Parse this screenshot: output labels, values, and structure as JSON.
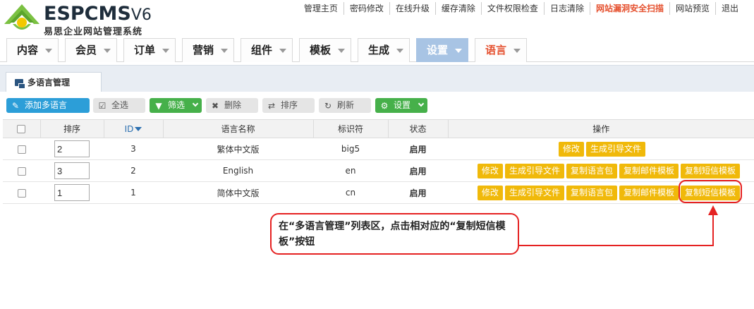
{
  "brand": {
    "name": "ESPCMS",
    "version": "V6",
    "subtitle": "易思企业网站管理系统"
  },
  "topnav": [
    "管理主页",
    "密码修改",
    "在线升级",
    "缓存清除",
    "文件权限检查",
    "日志清除",
    "网站漏洞安全扫描",
    "网站预览",
    "退出"
  ],
  "menu": [
    "内容",
    "会员",
    "订单",
    "营销",
    "组件",
    "模板",
    "生成",
    "设置",
    "语言"
  ],
  "tab": {
    "label": "多语言管理"
  },
  "toolbar": {
    "add": "添加多语言",
    "select_all": "全选",
    "filter": "筛选",
    "delete": "删除",
    "sort": "排序",
    "refresh": "刷新",
    "settings": "设置"
  },
  "table": {
    "headers": [
      "排序",
      "ID",
      "语言名称",
      "标识符",
      "状态",
      "操作"
    ],
    "rows": [
      {
        "sort": "2",
        "id": "3",
        "name": "繁体中文版",
        "code": "big5",
        "status": "启用",
        "ops": [
          "修改",
          "生成引导文件"
        ]
      },
      {
        "sort": "3",
        "id": "2",
        "name": "English",
        "code": "en",
        "status": "启用",
        "ops": [
          "修改",
          "生成引导文件",
          "复制语言包",
          "复制邮件模板",
          "复制短信模板"
        ]
      },
      {
        "sort": "1",
        "id": "1",
        "name": "简体中文版",
        "code": "cn",
        "status": "启用",
        "ops": [
          "修改",
          "生成引导文件",
          "复制语言包",
          "复制邮件模板",
          "复制短信模板"
        ]
      }
    ]
  },
  "annotation": {
    "text": "在“多语言管理”列表区，点击相对应的“复制短信模板”按钮"
  },
  "colors": {
    "accent_orange": "#f0b90a",
    "enabled_green": "#27922c",
    "active_menu": "#a8c4e4",
    "annotation_red": "#e52222"
  }
}
